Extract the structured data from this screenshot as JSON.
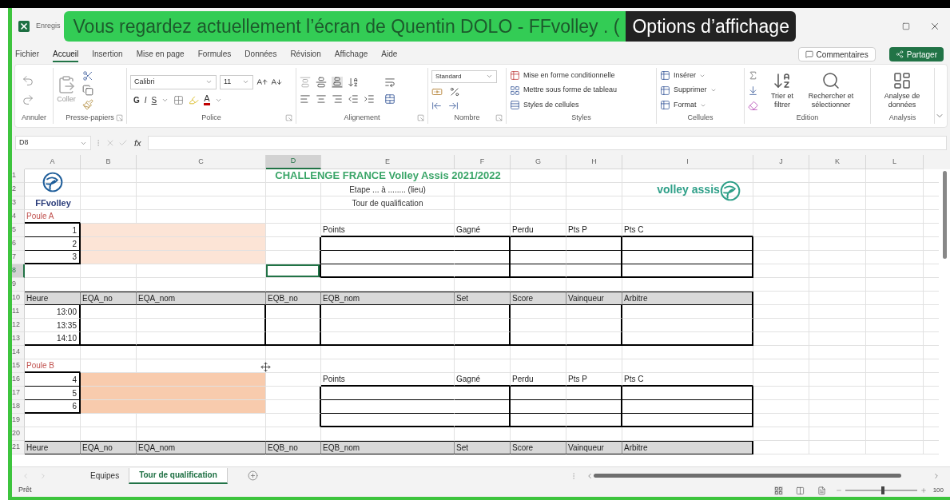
{
  "title_bar": {
    "app_title": "Enregis",
    "banner": "Vous regardez actuellement l’écran de Quentin DOLO - FFvolley . (",
    "options": "Options d’affichage"
  },
  "menu_tabs": [
    {
      "label": "Fichier",
      "selected": false
    },
    {
      "label": "Accueil",
      "selected": true
    },
    {
      "label": "Insertion",
      "selected": false
    },
    {
      "label": "Mise en page",
      "selected": false
    },
    {
      "label": "Formules",
      "selected": false
    },
    {
      "label": "Données",
      "selected": false
    },
    {
      "label": "Révision",
      "selected": false
    },
    {
      "label": "Affichage",
      "selected": false
    },
    {
      "label": "Aide",
      "selected": false
    }
  ],
  "header_buttons": {
    "comments": "Commentaires",
    "share": "Partager"
  },
  "ribbon": {
    "undo": {
      "label": "Annuler"
    },
    "clipboard": {
      "label": "Presse-papiers",
      "paste": "Coller"
    },
    "font": {
      "label": "Police",
      "family": "Calibri",
      "size": "11",
      "styles": [
        "G",
        "I",
        "S"
      ],
      "color_letter": "A"
    },
    "alignment": {
      "label": "Alignement"
    },
    "number": {
      "label": "Nombre",
      "format": "Standard"
    },
    "styles": {
      "label": "Styles",
      "items": [
        "Mise en forme conditionnelle",
        "Mettre sous forme de tableau",
        "Styles de cellules"
      ]
    },
    "cells": {
      "label": "Cellules",
      "items": [
        "Insérer",
        "Supprimer",
        "Format"
      ]
    },
    "editing": {
      "label": "Edition",
      "items": [
        "Trier et filtrer",
        "Rechercher et sélectionner"
      ]
    },
    "analysis": {
      "label": "Analysis",
      "items": [
        "Analyse de données"
      ]
    }
  },
  "formula_bar": {
    "name_box": "D8",
    "fx": "fx"
  },
  "columns": [
    {
      "label": "A",
      "selected": false
    },
    {
      "label": "B",
      "selected": false
    },
    {
      "label": "C",
      "selected": false
    },
    {
      "label": "D",
      "selected": true
    },
    {
      "label": "E",
      "selected": false
    },
    {
      "label": "F",
      "selected": false
    },
    {
      "label": "G",
      "selected": false
    },
    {
      "label": "H",
      "selected": false
    },
    {
      "label": "I",
      "selected": false
    },
    {
      "label": "J",
      "selected": false
    },
    {
      "label": "K",
      "selected": false
    },
    {
      "label": "L",
      "selected": false
    }
  ],
  "logos": {
    "left": "FFvolley",
    "right": "volley assis"
  },
  "rows": [
    {
      "number": "1",
      "kind": "title",
      "selected": false,
      "cells": {
        "D": "CHALLENGE FRANCE Volley Assis 2021/2022"
      }
    },
    {
      "number": "2",
      "kind": "sub",
      "selected": false,
      "cells": {
        "E": "Etape ... à ........ (lieu)"
      }
    },
    {
      "number": "3",
      "kind": "sub",
      "selected": false,
      "cells": {
        "E": "Tour de qualification"
      }
    },
    {
      "number": "4",
      "kind": "pool",
      "selected": false,
      "cells": {
        "A": "Poule A"
      }
    },
    {
      "number": "5",
      "kind": "team-head",
      "selected": false,
      "color": "#fce4d6",
      "cells": {
        "A": "1",
        "E": "Points",
        "F": "Gagné",
        "G": "Perdu",
        "H": "Pts P",
        "I": "Pts C"
      }
    },
    {
      "number": "6",
      "kind": "team",
      "selected": false,
      "color": "#fce4d6",
      "cells": {
        "A": "2"
      }
    },
    {
      "number": "7",
      "kind": "team-last",
      "selected": false,
      "color": "#fce4d6",
      "cells": {
        "A": "3"
      }
    },
    {
      "number": "8",
      "kind": "standings-end",
      "selected": true
    },
    {
      "number": "9",
      "kind": "plain",
      "selected": false
    },
    {
      "number": "10",
      "kind": "header",
      "selected": false,
      "cells": {
        "A": "Heure",
        "B": "EQA_no",
        "C": "EQA_nom",
        "D": "EQB_no",
        "E": "EQB_nom",
        "F": "Set",
        "G": "Score",
        "H": "Vainqueur",
        "I": "Arbitre"
      }
    },
    {
      "number": "11",
      "kind": "match",
      "selected": false,
      "cells": {
        "A": "13:00"
      }
    },
    {
      "number": "12",
      "kind": "match",
      "selected": false,
      "cells": {
        "A": "13:35"
      }
    },
    {
      "number": "13",
      "kind": "match-end",
      "selected": false,
      "cells": {
        "A": "14:10"
      }
    },
    {
      "number": "14",
      "kind": "plain",
      "selected": false
    },
    {
      "number": "15",
      "kind": "pool",
      "selected": false,
      "cells": {
        "A": "Poule B"
      }
    },
    {
      "number": "16",
      "kind": "team-head",
      "selected": false,
      "color": "#f8cbad",
      "cells": {
        "A": "4",
        "E": "Points",
        "F": "Gagné",
        "G": "Perdu",
        "H": "Pts P",
        "I": "Pts C"
      }
    },
    {
      "number": "17",
      "kind": "team",
      "selected": false,
      "color": "#f8cbad",
      "cells": {
        "A": "5"
      }
    },
    {
      "number": "18",
      "kind": "team-last",
      "selected": false,
      "color": "#f8cbad",
      "cells": {
        "A": "6"
      }
    },
    {
      "number": "19",
      "kind": "standings-end",
      "selected": false
    },
    {
      "number": "20",
      "kind": "plain",
      "selected": false
    },
    {
      "number": "21",
      "kind": "header",
      "selected": false,
      "cells": {
        "A": "Heure",
        "B": "EQA_no",
        "C": "EQA_nom",
        "D": "EQB_no",
        "E": "EQB_nom",
        "F": "Set",
        "G": "Score",
        "H": "Vainqueur",
        "I": "Arbitre"
      }
    }
  ],
  "sheet_tabs": [
    {
      "label": "Equipes",
      "selected": false
    },
    {
      "label": "Tour de qualification",
      "selected": true
    }
  ],
  "status_bar": {
    "text": "Prêt",
    "zoom": "100",
    "zoom_slider": {
      "level": 0.5
    }
  }
}
